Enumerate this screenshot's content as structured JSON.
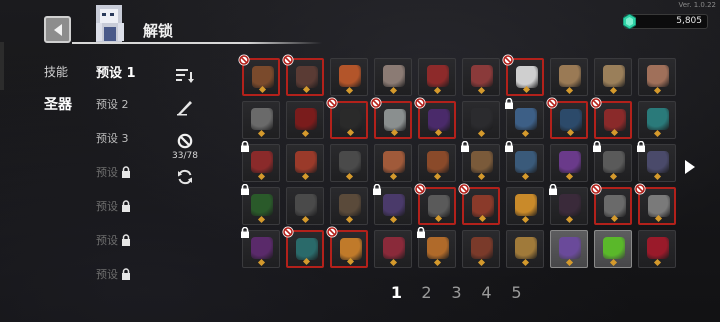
{
  "version": "Ver. 1.0.22",
  "currency": {
    "icon": "gem-icon",
    "value": "5,805"
  },
  "header": {
    "title": "解锁",
    "back_icon": "back-arrow-icon",
    "portrait_icon": "character-portrait-icon"
  },
  "categories": [
    {
      "label": "技能",
      "active": false
    },
    {
      "label": "圣器",
      "active": true
    }
  ],
  "presets": [
    {
      "label": "预设 1",
      "active": true,
      "locked": false
    },
    {
      "label": "预设 2",
      "active": false,
      "locked": false
    },
    {
      "label": "预设 3",
      "active": false,
      "locked": false
    },
    {
      "label": "预设",
      "active": false,
      "locked": true
    },
    {
      "label": "预设",
      "active": false,
      "locked": true
    },
    {
      "label": "预设",
      "active": false,
      "locked": true
    },
    {
      "label": "预设",
      "active": false,
      "locked": true
    }
  ],
  "tools": {
    "sort_icon": "sort-icon",
    "edit_icon": "quill-icon",
    "ban_icon": "ban-icon",
    "ban_count": "33/78",
    "refresh_icon": "refresh-icon"
  },
  "colors": {
    "banned_border": "#b3211b",
    "star": "#d59a2c",
    "accent": "#2ed3a6"
  },
  "grid": {
    "rows": [
      [
        {
          "state": "banned",
          "locked": false,
          "icon": "bread-relic-icon",
          "color": "#7a4a2c"
        },
        {
          "state": "banned",
          "locked": false,
          "icon": "bat-relic-icon",
          "color": "#5a3b34"
        },
        {
          "state": "normal",
          "locked": false,
          "icon": "amber-gem-icon",
          "color": "#b3552a"
        },
        {
          "state": "normal",
          "locked": false,
          "icon": "feather-icon",
          "color": "#8b7b74"
        },
        {
          "state": "normal",
          "locked": false,
          "icon": "potion-icon",
          "color": "#8d2a2a"
        },
        {
          "state": "normal",
          "locked": false,
          "icon": "demon-mask-icon",
          "color": "#8a3a3a"
        },
        {
          "state": "banned",
          "locked": false,
          "icon": "skull-icon",
          "color": "#cfcfcf"
        },
        {
          "state": "normal",
          "locked": false,
          "icon": "scroll-icon",
          "color": "#9a7a55"
        },
        {
          "state": "normal",
          "locked": false,
          "icon": "map-icon",
          "color": "#9a7f5a"
        },
        {
          "state": "normal",
          "locked": false,
          "icon": "book-icon",
          "color": "#a0705a"
        }
      ],
      [
        {
          "state": "normal",
          "locked": false,
          "icon": "chain-icon",
          "color": "#6a6a6a"
        },
        {
          "state": "normal",
          "locked": false,
          "icon": "berries-icon",
          "color": "#7a1c1c"
        },
        {
          "state": "banned",
          "locked": false,
          "icon": "hat-icon",
          "color": "#2a2a2a"
        },
        {
          "state": "banned",
          "locked": false,
          "icon": "blade-icon",
          "color": "#8a8f8f"
        },
        {
          "state": "banned",
          "locked": false,
          "icon": "purple-crystal-icon",
          "color": "#4a2a6a"
        },
        {
          "state": "normal",
          "locked": false,
          "icon": "dark-stone-icon",
          "color": "#2b2b2e"
        },
        {
          "state": "normal",
          "locked": true,
          "icon": "blue-flower-icon",
          "color": "#3d5f86"
        },
        {
          "state": "banned",
          "locked": false,
          "icon": "blue-cluster-icon",
          "color": "#2c4a6a"
        },
        {
          "state": "banned",
          "locked": false,
          "icon": "mushroom-icon",
          "color": "#8a2a2a"
        },
        {
          "state": "normal",
          "locked": false,
          "icon": "teal-orbs-icon",
          "color": "#2a7a7a"
        }
      ],
      [
        {
          "state": "normal",
          "locked": true,
          "icon": "red-flower-icon",
          "color": "#8a2a2a"
        },
        {
          "state": "normal",
          "locked": false,
          "icon": "pepper-icon",
          "color": "#9a3a2a"
        },
        {
          "state": "normal",
          "locked": false,
          "icon": "wand-icon",
          "color": "#4a4a4a"
        },
        {
          "state": "normal",
          "locked": false,
          "icon": "boot-icon",
          "color": "#a05a3a"
        },
        {
          "state": "normal",
          "locked": false,
          "icon": "pouch-icon",
          "color": "#8a4a2a"
        },
        {
          "state": "normal",
          "locked": true,
          "icon": "plank-icon",
          "color": "#7a5a3a"
        },
        {
          "state": "normal",
          "locked": true,
          "icon": "crystal-ball-icon",
          "color": "#3a5a7a"
        },
        {
          "state": "normal",
          "locked": false,
          "icon": "purple-lantern-icon",
          "color": "#6a3a8a"
        },
        {
          "state": "normal",
          "locked": true,
          "icon": "totem-icon",
          "color": "#5a5a5a"
        },
        {
          "state": "normal",
          "locked": true,
          "icon": "helmet-icon",
          "color": "#4a4a6a"
        }
      ],
      [
        {
          "state": "normal",
          "locked": true,
          "icon": "green-ring-icon",
          "color": "#2a5a2a"
        },
        {
          "state": "normal",
          "locked": false,
          "icon": "gun-icon",
          "color": "#4a4a4a"
        },
        {
          "state": "normal",
          "locked": false,
          "icon": "gauntlet-icon",
          "color": "#5a4a3a"
        },
        {
          "state": "normal",
          "locked": true,
          "icon": "purple-staff-icon",
          "color": "#4a3a6a"
        },
        {
          "state": "banned",
          "locked": false,
          "icon": "crossed-blades-icon",
          "color": "#5a5a5a"
        },
        {
          "state": "banned",
          "locked": false,
          "icon": "red-sash-icon",
          "color": "#8a3a2a"
        },
        {
          "state": "normal",
          "locked": false,
          "icon": "gold-bar-icon",
          "color": "#c98a2a"
        },
        {
          "state": "normal",
          "locked": true,
          "icon": "crow-icon",
          "color": "#3a2a3a"
        },
        {
          "state": "banned",
          "locked": false,
          "icon": "dagger-icon",
          "color": "#6a6a6a"
        },
        {
          "state": "banned",
          "locked": false,
          "icon": "sword-icon",
          "color": "#7a7a7a"
        }
      ],
      [
        {
          "state": "normal",
          "locked": true,
          "icon": "purple-eye-icon",
          "color": "#5a2a6a"
        },
        {
          "state": "banned",
          "locked": false,
          "icon": "teal-spider-icon",
          "color": "#2a6a6a"
        },
        {
          "state": "banned",
          "locked": false,
          "icon": "gold-pile-icon",
          "color": "#c07a2a"
        },
        {
          "state": "normal",
          "locked": false,
          "icon": "red-boots-icon",
          "color": "#8a2a3a"
        },
        {
          "state": "normal",
          "locked": true,
          "icon": "bronze-coin-icon",
          "color": "#b06a2a"
        },
        {
          "state": "normal",
          "locked": false,
          "icon": "hook-icon",
          "color": "#7a3a2a"
        },
        {
          "state": "normal",
          "locked": false,
          "icon": "coin-icon",
          "color": "#a07a3a"
        },
        {
          "state": "selected",
          "locked": false,
          "icon": "purple-creature-icon",
          "color": "#6a4a9a"
        },
        {
          "state": "selected",
          "locked": false,
          "icon": "green-sprout-icon",
          "color": "#5ab82a"
        },
        {
          "state": "normal",
          "locked": false,
          "icon": "red-heart-icon",
          "color": "#9a1a2a"
        }
      ]
    ]
  },
  "pagination": {
    "pages": [
      "1",
      "2",
      "3",
      "4",
      "5"
    ],
    "current": "1",
    "next_icon": "next-page-arrow-icon"
  }
}
